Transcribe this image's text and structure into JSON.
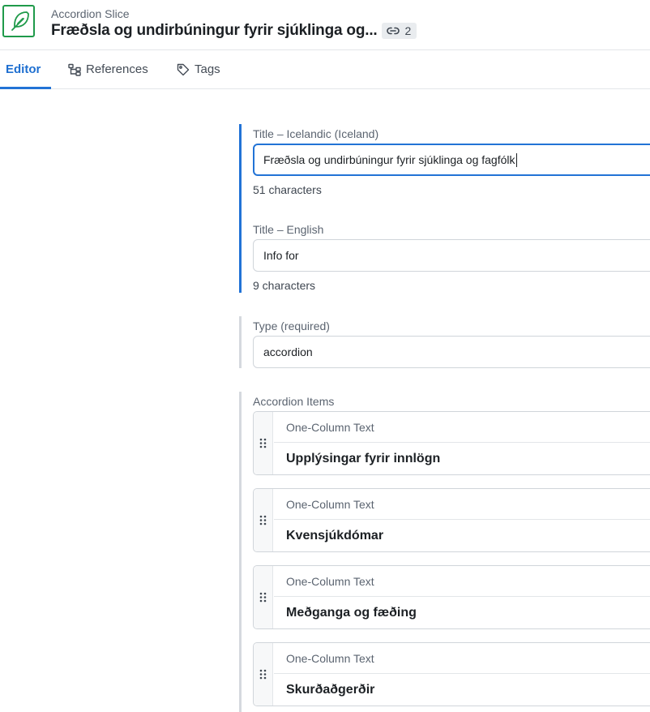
{
  "header": {
    "entry_type": "Accordion Slice",
    "title": "Fræðsla og undirbúningur fyrir sjúklinga og...",
    "references_count": "2",
    "icon": "feather-pen-icon",
    "brand_color": "#1f9a4a"
  },
  "tabs": [
    {
      "label": "Editor",
      "icon": "pencil-icon",
      "active": true
    },
    {
      "label": "References",
      "icon": "hierarchy-icon",
      "active": false
    },
    {
      "label": "Tags",
      "icon": "tag-icon",
      "active": false
    }
  ],
  "fields": {
    "title_is": {
      "label": "Title – Icelandic (Iceland)",
      "value": "Fræðsla og undirbúningur fyrir sjúklinga og fagfólk",
      "count": "51 characters"
    },
    "title_en": {
      "label": "Title – English",
      "value": "Info for",
      "count": "9 characters"
    },
    "type": {
      "label": "Type (required)",
      "value": "accordion"
    },
    "accordion_items": {
      "label": "Accordion Items",
      "items": [
        {
          "type": "One-Column Text",
          "title": "Upplýsingar fyrir innlögn"
        },
        {
          "type": "One-Column Text",
          "title": "Kvensjúkdómar"
        },
        {
          "type": "One-Column Text",
          "title": "Meðganga og fæðing"
        },
        {
          "type": "One-Column Text",
          "title": "Skurðaðgerðir"
        }
      ]
    }
  },
  "colors": {
    "accent": "#2273d6",
    "border": "#d0d5da"
  }
}
